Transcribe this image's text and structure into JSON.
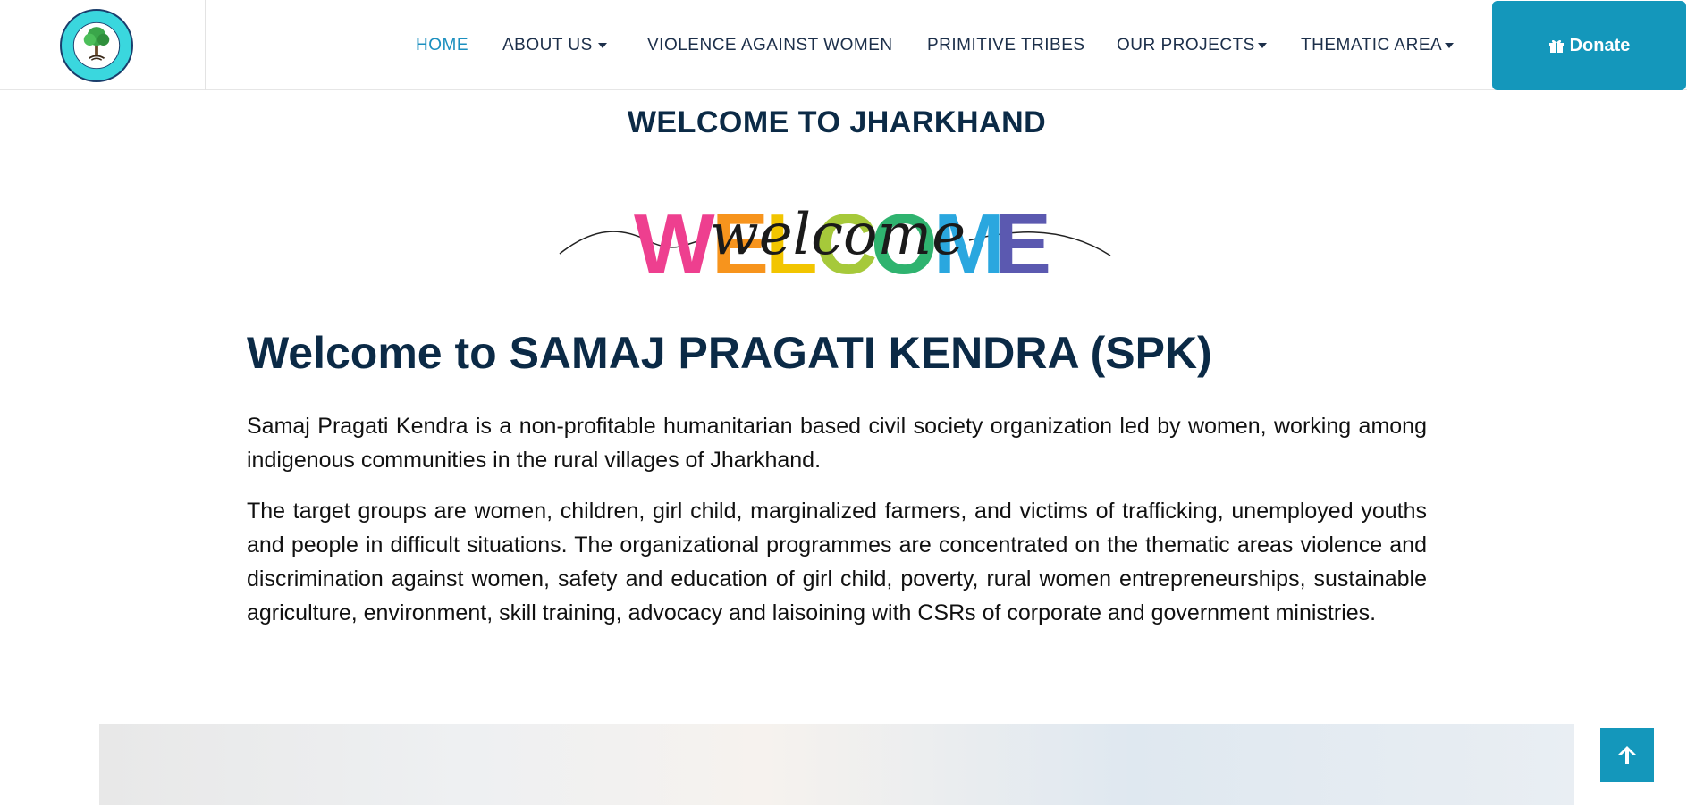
{
  "header": {
    "logo_alt": "SAMAJ PRAGATI KENDRA",
    "nav": [
      {
        "label": "HOME",
        "active": true
      },
      {
        "label": "ABOUT US",
        "dropdown": true
      },
      {
        "label": "VIOLENCE AGAINST WOMEN"
      },
      {
        "label": "PRIMITIVE TRIBES"
      },
      {
        "label": "OUR PROJECTS",
        "dropdown": true
      },
      {
        "label": "THEMATIC AREA",
        "dropdown": true
      }
    ],
    "donate_label": "Donate"
  },
  "main": {
    "section_title": "WELCOME TO JHARKHAND",
    "welcome_art_text": "WELCOME",
    "welcome_script": "welcome",
    "headline": "Welcome to SAMAJ PRAGATI KENDRA (SPK)",
    "paragraph1": "Samaj Pragati Kendra is a non-profitable humanitarian based civil society organization led by women, working among indigenous communities in the rural villages of Jharkhand.",
    "paragraph2": "The target groups are women, children, girl child, marginalized farmers, and victims of trafficking, unemployed youths and people in difficult situations. The organizational programmes are concentrated on the thematic areas violence and discrimination against women, safety and education of girl child, poverty, rural women entrepreneurships, sustainable agriculture, environment, skill training, advocacy and laisoining with CSRs of corporate and government ministries."
  },
  "colors": {
    "accent": "#1497bb",
    "heading": "#0b2a46",
    "active_nav": "#1b8fbf",
    "welcome_letters": [
      "#ee3f8f",
      "#f7941d",
      "#f2c500",
      "#a6c93a",
      "#2fb36f",
      "#2aa7df",
      "#5b59b0"
    ]
  },
  "icons": {
    "donate": "gift-icon",
    "scroll_top": "arrow-up-icon"
  }
}
